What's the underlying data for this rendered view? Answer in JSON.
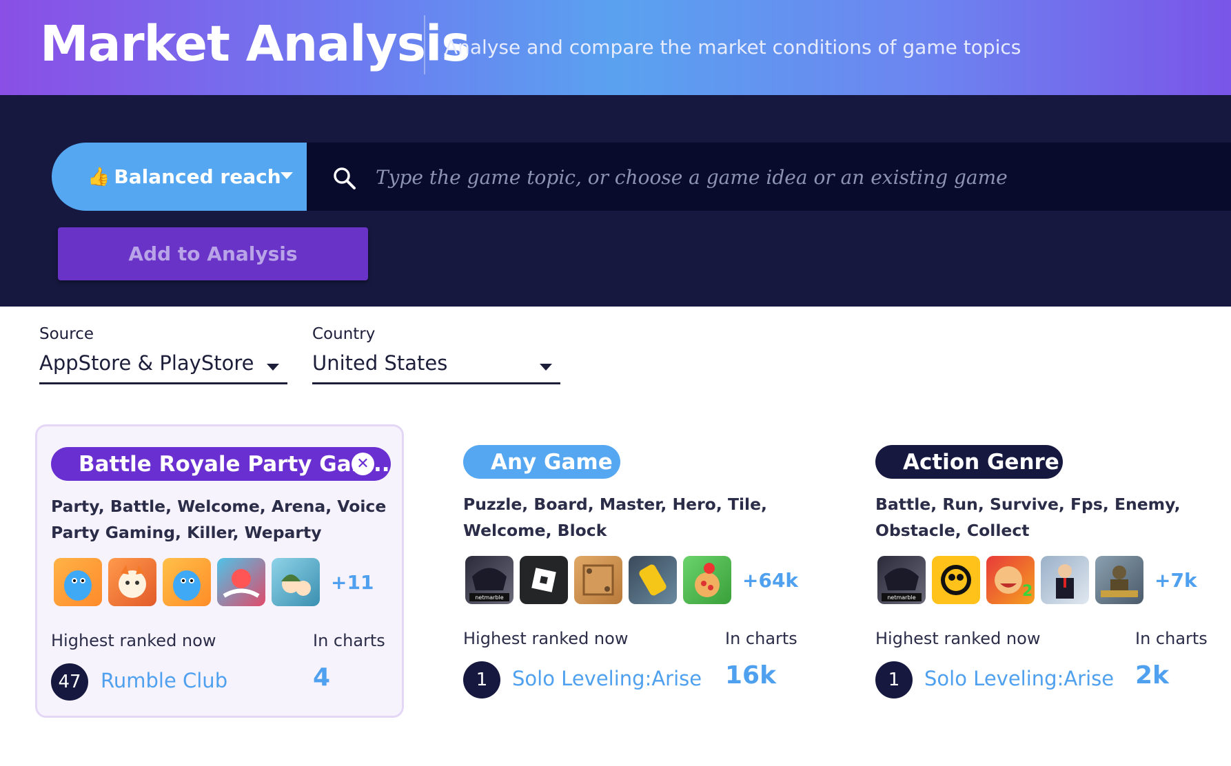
{
  "header": {
    "title": "Market Analysis",
    "subtitle": "Analyse and compare the market conditions of game topics"
  },
  "search_bar": {
    "reach_icon": "👍",
    "reach_label": "Balanced reach",
    "placeholder": "Type the game topic, or choose a game idea or an existing game",
    "add_button_label": "Add to Analysis"
  },
  "filters": {
    "source_label": "Source",
    "source_value": "AppStore & PlayStore",
    "country_label": "Country",
    "country_value": "United States"
  },
  "cards": [
    {
      "title": "Battle Royale Party Gam...",
      "pill_color": "#6a2fd0",
      "keywords": "Party, Battle, Welcome, Arena, Voice Party Gaming, Killer, Weparty",
      "more": "+11",
      "highest_label": "Highest ranked now",
      "charts_label": "In charts",
      "rank": "47",
      "game": "Rumble Club",
      "in_charts": "4",
      "close_icon": "close-icon"
    },
    {
      "title": "Any Game",
      "pill_color": "#55a7f1",
      "keywords": "Puzzle, Board, Master, Hero, Tile, Welcome, Block",
      "more": "+64k",
      "highest_label": "Highest ranked now",
      "charts_label": "In charts",
      "rank": "1",
      "game": "Solo Leveling:Arise",
      "in_charts": "16k"
    },
    {
      "title": "Action Genre",
      "pill_color": "#16183f",
      "keywords": "Battle, Run, Survive, Fps, Enemy, Obstacle, Collect",
      "more": "+7k",
      "highest_label": "Highest ranked now",
      "charts_label": "In charts",
      "rank": "1",
      "game": "Solo Leveling:Arise",
      "in_charts": "2k"
    }
  ]
}
